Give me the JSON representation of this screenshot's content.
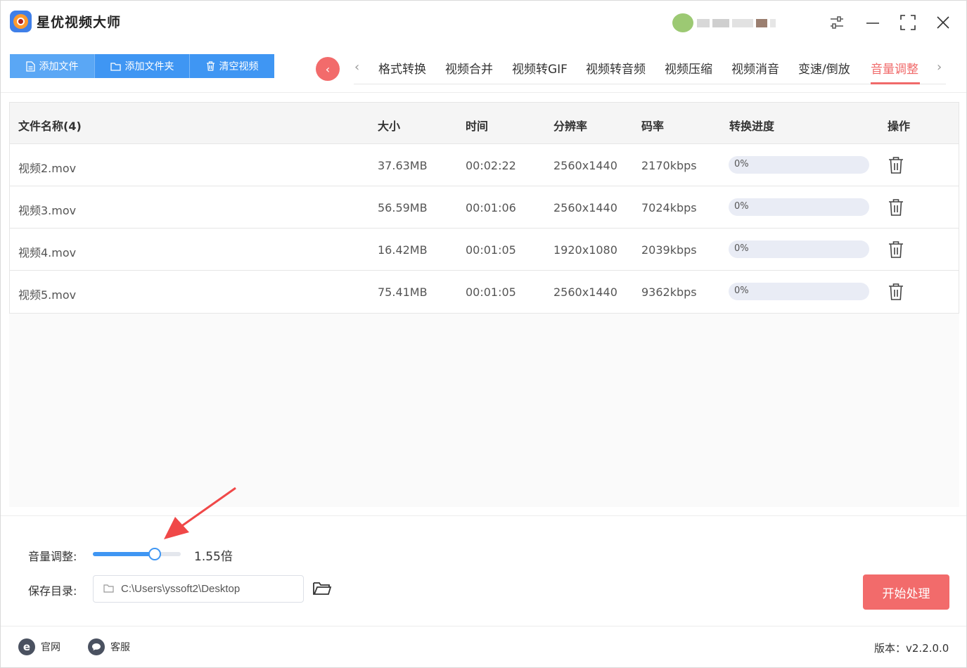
{
  "app": {
    "title": "星优视频大师"
  },
  "colors": {
    "accent_blue": "#3f96f3",
    "accent_red": "#f26b6b",
    "tab_active": "#f06a6a"
  },
  "toolbar": {
    "add_file": "添加文件",
    "add_folder": "添加文件夹",
    "clear_videos": "清空视频"
  },
  "tabs": [
    {
      "label": "格式转换"
    },
    {
      "label": "视频合并"
    },
    {
      "label": "视频转GIF"
    },
    {
      "label": "视频转音频"
    },
    {
      "label": "视频压缩"
    },
    {
      "label": "视频消音"
    },
    {
      "label": "变速/倒放"
    },
    {
      "label": "音量调整",
      "active": true
    }
  ],
  "table": {
    "headers": {
      "name": "文件名称(4)",
      "size": "大小",
      "time": "时间",
      "resolution": "分辨率",
      "bitrate": "码率",
      "progress": "转换进度",
      "action": "操作"
    },
    "rows": [
      {
        "name": "视频2.mov",
        "size": "37.63MB",
        "time": "00:02:22",
        "resolution": "2560x1440",
        "bitrate": "2170kbps",
        "progress_text": "0%",
        "progress": 0
      },
      {
        "name": "视频3.mov",
        "size": "56.59MB",
        "time": "00:01:06",
        "resolution": "2560x1440",
        "bitrate": "7024kbps",
        "progress_text": "0%",
        "progress": 0
      },
      {
        "name": "视频4.mov",
        "size": "16.42MB",
        "time": "00:01:05",
        "resolution": "1920x1080",
        "bitrate": "2039kbps",
        "progress_text": "0%",
        "progress": 0
      },
      {
        "name": "视频5.mov",
        "size": "75.41MB",
        "time": "00:01:05",
        "resolution": "2560x1440",
        "bitrate": "9362kbps",
        "progress_text": "0%",
        "progress": 0
      }
    ]
  },
  "settings": {
    "volume_label": "音量调整:",
    "volume_value_text": "1.55倍",
    "volume_fraction": 0.7,
    "save_dir_label": "保存目录:",
    "save_dir_value": "C:\\Users\\yssoft2\\Desktop"
  },
  "actions": {
    "start": "开始处理"
  },
  "footer": {
    "website": "官网",
    "support": "客服",
    "version": "版本：v2.2.0.0"
  },
  "icons": [
    "app-logo-icon",
    "settings-sliders-icon",
    "minimize-icon",
    "maximize-icon",
    "close-icon",
    "document-icon",
    "folder-icon",
    "trash-icon",
    "chevron-left-icon",
    "chevron-right-icon",
    "folder-open-icon",
    "ie-icon",
    "chat-icon"
  ]
}
